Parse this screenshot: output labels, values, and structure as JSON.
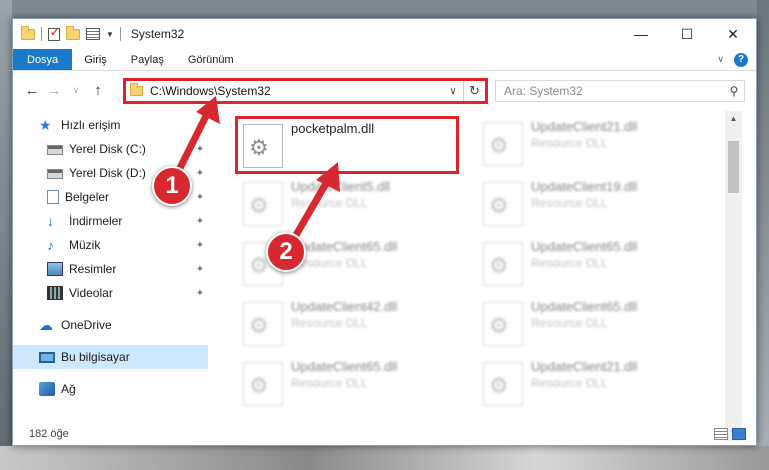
{
  "window": {
    "title": "System32"
  },
  "ribbon": {
    "tabs": [
      "Dosya",
      "Giriş",
      "Paylaş",
      "Görünüm"
    ]
  },
  "address": {
    "path": "C:\\Windows\\System32"
  },
  "search": {
    "placeholder": "Ara: System32"
  },
  "sidebar": {
    "quick_access": "Hızlı erişim",
    "items": [
      {
        "label": "Yerel Disk (C:)",
        "icon": "drive-icon"
      },
      {
        "label": "Yerel Disk (D:)",
        "icon": "drive-icon"
      },
      {
        "label": "Belgeler",
        "icon": "documents-icon"
      },
      {
        "label": "İndirmeler",
        "icon": "downloads-icon"
      },
      {
        "label": "Müzik",
        "icon": "music-icon"
      },
      {
        "label": "Resimler",
        "icon": "pictures-icon"
      },
      {
        "label": "Videolar",
        "icon": "videos-icon"
      }
    ],
    "onedrive": "OneDrive",
    "this_pc": "Bu bilgisayar",
    "network": "Ağ"
  },
  "files": {
    "highlighted": {
      "name": "pocketpalm.dll"
    },
    "left": [
      {
        "name": "UpdateClient5.dll",
        "type": "Resource DLL"
      },
      {
        "name": "UpdateClient65.dll",
        "type": "Resource DLL"
      },
      {
        "name": "UpdateClient42.dll",
        "type": "Resource DLL"
      },
      {
        "name": "UpdateClient65.dll",
        "type": "Resource DLL"
      }
    ],
    "right": [
      {
        "name": "UpdateClient21.dll",
        "type": "Resource DLL"
      },
      {
        "name": "UpdateClient19.dll",
        "type": "Resource DLL"
      },
      {
        "name": "UpdateClient65.dll",
        "type": "Resource DLL"
      },
      {
        "name": "UpdateClient65.dll",
        "type": "Resource DLL"
      },
      {
        "name": "UpdateClient21.dll",
        "type": "Resource DLL"
      }
    ]
  },
  "status": {
    "count": "182 öğe"
  },
  "callouts": {
    "one": "1",
    "two": "2"
  },
  "colors": {
    "accent": "#1979ca",
    "highlight": "#e0222b",
    "selection": "#cde8ff"
  }
}
